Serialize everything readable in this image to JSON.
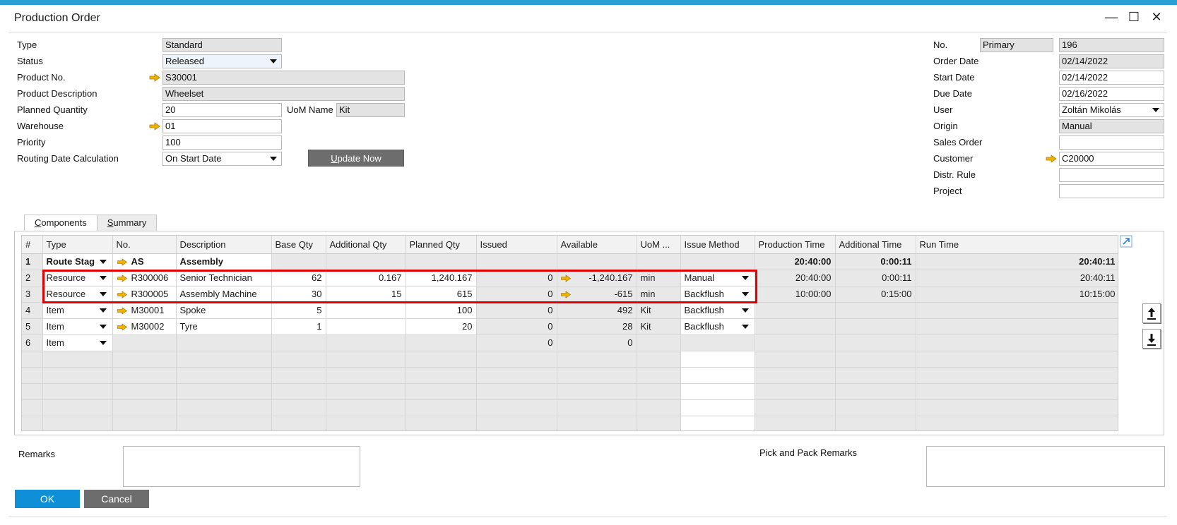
{
  "window": {
    "title": "Production Order",
    "controls": [
      "minimize-icon",
      "maximize-icon",
      "close-icon"
    ]
  },
  "header_left": {
    "type_label": "Type",
    "type_value": "Standard",
    "status_label": "Status",
    "status_value": "Released",
    "product_no_label": "Product No.",
    "product_no_value": "S30001",
    "product_desc_label": "Product Description",
    "product_desc_value": "Wheelset",
    "planned_qty_label": "Planned Quantity",
    "planned_qty_value": "20",
    "uom_name_label": "UoM Name",
    "uom_name_value": "Kit",
    "warehouse_label": "Warehouse",
    "warehouse_value": "01",
    "priority_label": "Priority",
    "priority_value": "100",
    "routing_label": "Routing Date Calculation",
    "routing_value": "On Start Date",
    "update_now_accel": "U",
    "update_now_rest": "pdate Now"
  },
  "header_right": {
    "no_label": "No.",
    "series_value": "Primary",
    "no_value": "196",
    "order_date_label": "Order Date",
    "order_date_value": "02/14/2022",
    "start_date_label": "Start Date",
    "start_date_value": "02/14/2022",
    "due_date_label": "Due Date",
    "due_date_value": "02/16/2022",
    "user_label": "User",
    "user_value": "Zoltán Mikolás",
    "origin_label": "Origin",
    "origin_value": "Manual",
    "sales_order_label": "Sales Order",
    "sales_order_value": "",
    "customer_label": "Customer",
    "customer_value": "C20000",
    "distr_rule_label": "Distr. Rule",
    "distr_rule_value": "",
    "project_label": "Project",
    "project_value": ""
  },
  "tabs": [
    {
      "accel": "C",
      "rest": "omponents"
    },
    {
      "accel": "S",
      "rest": "ummary"
    }
  ],
  "grid": {
    "columns": [
      "#",
      "Type",
      "No.",
      "Description",
      "Base Qty",
      "Additional Qty",
      "Planned Qty",
      "Issued",
      "Available",
      "UoM ...",
      "Issue Method",
      "Production Time",
      "Additional Time",
      "Run Time"
    ],
    "rows": [
      {
        "n": "1",
        "type": "Route Stag",
        "no": "AS",
        "desc": "Assembly",
        "base": "",
        "addl": "",
        "planned": "",
        "issued": "",
        "avail": "",
        "uom": "",
        "method": "",
        "prod_time": "20:40:00",
        "addl_time": "0:00:11",
        "run_time": "20:40:11"
      },
      {
        "n": "2",
        "type": "Resource",
        "no": "R300006",
        "desc": "Senior Technician",
        "base": "62",
        "addl": "0.167",
        "planned": "1,240.167",
        "issued": "0",
        "avail": "-1,240.167",
        "uom": "min",
        "method": "Manual",
        "prod_time": "20:40:00",
        "addl_time": "0:00:11",
        "run_time": "20:40:11"
      },
      {
        "n": "3",
        "type": "Resource",
        "no": "R300005",
        "desc": "Assembly Machine",
        "base": "30",
        "addl": "15",
        "planned": "615",
        "issued": "0",
        "avail": "-615",
        "uom": "min",
        "method": "Backflush",
        "prod_time": "10:00:00",
        "addl_time": "0:15:00",
        "run_time": "10:15:00"
      },
      {
        "n": "4",
        "type": "Item",
        "no": "M30001",
        "desc": "Spoke",
        "base": "5",
        "addl": "",
        "planned": "100",
        "issued": "0",
        "avail": "492",
        "uom": "Kit",
        "method": "Backflush",
        "prod_time": "",
        "addl_time": "",
        "run_time": ""
      },
      {
        "n": "5",
        "type": "Item",
        "no": "M30002",
        "desc": "Tyre",
        "base": "1",
        "addl": "",
        "planned": "20",
        "issued": "0",
        "avail": "28",
        "uom": "Kit",
        "method": "Backflush",
        "prod_time": "",
        "addl_time": "",
        "run_time": ""
      },
      {
        "n": "6",
        "type": "Item",
        "no": "",
        "desc": "",
        "base": "",
        "addl": "",
        "planned": "",
        "issued": "0",
        "avail": "0",
        "uom": "",
        "method": "",
        "prod_time": "",
        "addl_time": "",
        "run_time": ""
      }
    ]
  },
  "footer": {
    "remarks_label": "Remarks",
    "remarks_value": "",
    "pick_pack_label": "Pick and Pack Remarks",
    "pick_pack_value": "",
    "ok_label": "OK",
    "cancel_label": "Cancel"
  },
  "colors": {
    "accent": "#0e8fd6",
    "link_arrow": "#f0b400",
    "highlight": "#e00000",
    "readonly_bg": "#e3e3e3"
  }
}
